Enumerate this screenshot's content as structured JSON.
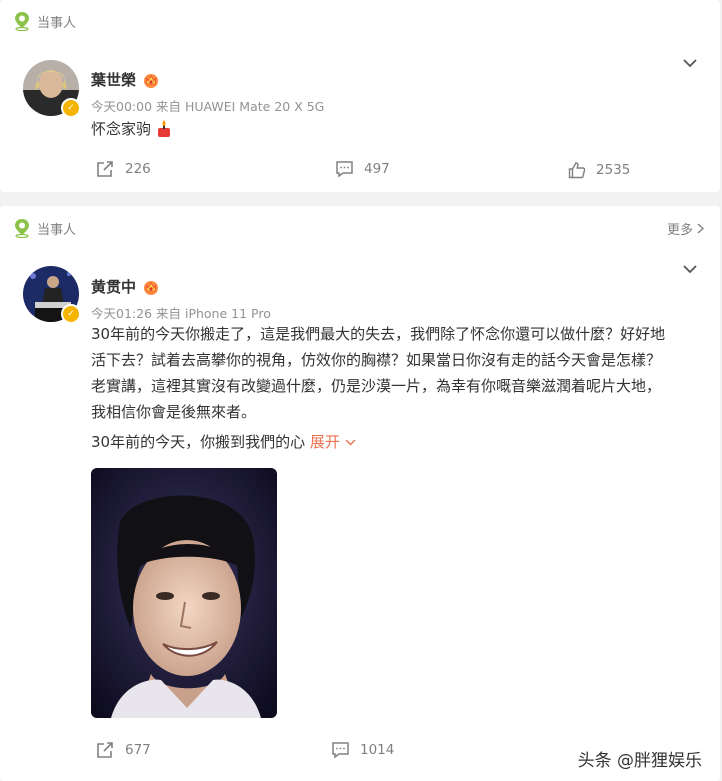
{
  "posts": [
    {
      "source_label": "当事人",
      "username": "葉世榮",
      "meta": "今天00:00  来自 HUAWEI Mate 20 X 5G",
      "text": "怀念家驹",
      "actions": {
        "repost": "226",
        "comment": "497",
        "like": "2535"
      }
    },
    {
      "source_label": "当事人",
      "more_label": "更多",
      "username": "黄贯中",
      "meta": "今天01:26  来自 iPhone 11 Pro",
      "text_lines": [
        "30年前的今天你搬走了，這是我們最大的失去，我們除了怀念你還可以做什麼？好好地",
        "活下去？試着去高攀你的視角，仿效你的胸襟？如果當日你沒有走的話今天會是怎樣？",
        "老實講，這裡其實沒有改變過什麼，仍是沙漠一片，為幸有你嘅音樂滋潤着呢片大地，",
        "我相信你會是後無來者。"
      ],
      "subtitle": "30年前的今天，你搬到我們的心",
      "expand_label": "展开",
      "actions": {
        "repost": "677",
        "comment": "1014"
      }
    }
  ],
  "watermark": "头条 @胖狸娱乐",
  "colors": {
    "source_icon": "#8bc34a",
    "verified": "#f4b400",
    "expand_link": "#eb7350"
  }
}
